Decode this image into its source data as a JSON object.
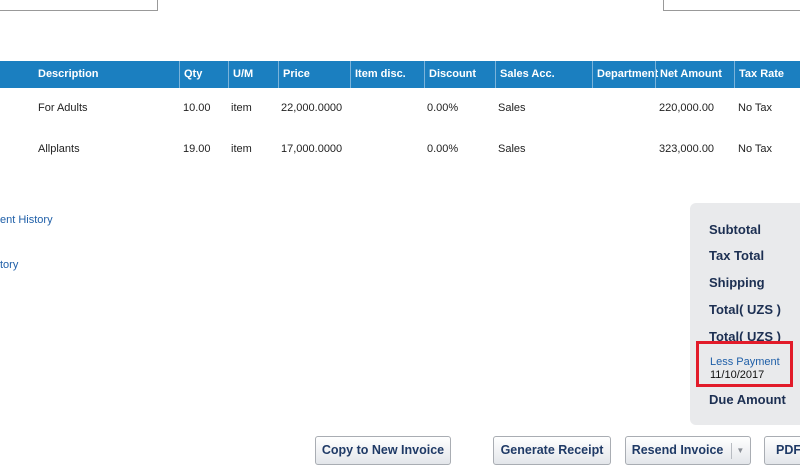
{
  "table": {
    "headers": [
      "Description",
      "Qty",
      "U/M",
      "Price",
      "Item disc.",
      "Discount",
      "Sales Acc.",
      "Department",
      "Net Amount",
      "Tax Rate"
    ],
    "rows": [
      {
        "description": "For Adults",
        "qty": "10.00",
        "um": "item",
        "price": "22,000.0000",
        "item_disc": "",
        "discount": "0.00%",
        "sales_acc": "Sales",
        "department": "",
        "net_amount": "220,000.00",
        "tax_rate": "No Tax"
      },
      {
        "description": "Allplants",
        "qty": "19.00",
        "um": "item",
        "price": "17,000.0000",
        "item_disc": "",
        "discount": "0.00%",
        "sales_acc": "Sales",
        "department": "",
        "net_amount": "323,000.00",
        "tax_rate": "No Tax"
      }
    ]
  },
  "history_links": {
    "payment_history": "ent History",
    "history": "tory"
  },
  "totals": {
    "subtotal": "Subtotal",
    "tax_total": "Tax Total",
    "shipping": "Shipping",
    "total1": "Total( UZS )",
    "total2": "Total( UZS )",
    "less_payment_label": "Less Payment",
    "less_payment_date": "11/10/2017",
    "due_amount": "Due Amount"
  },
  "buttons": {
    "copy": "Copy to New Invoice",
    "receipt": "Generate Receipt",
    "resend": "Resend Invoice",
    "pdf": "PDF"
  },
  "colors": {
    "header_bg": "#1b7fc0",
    "highlight": "#e21b2a",
    "link": "#1f5fa8"
  }
}
